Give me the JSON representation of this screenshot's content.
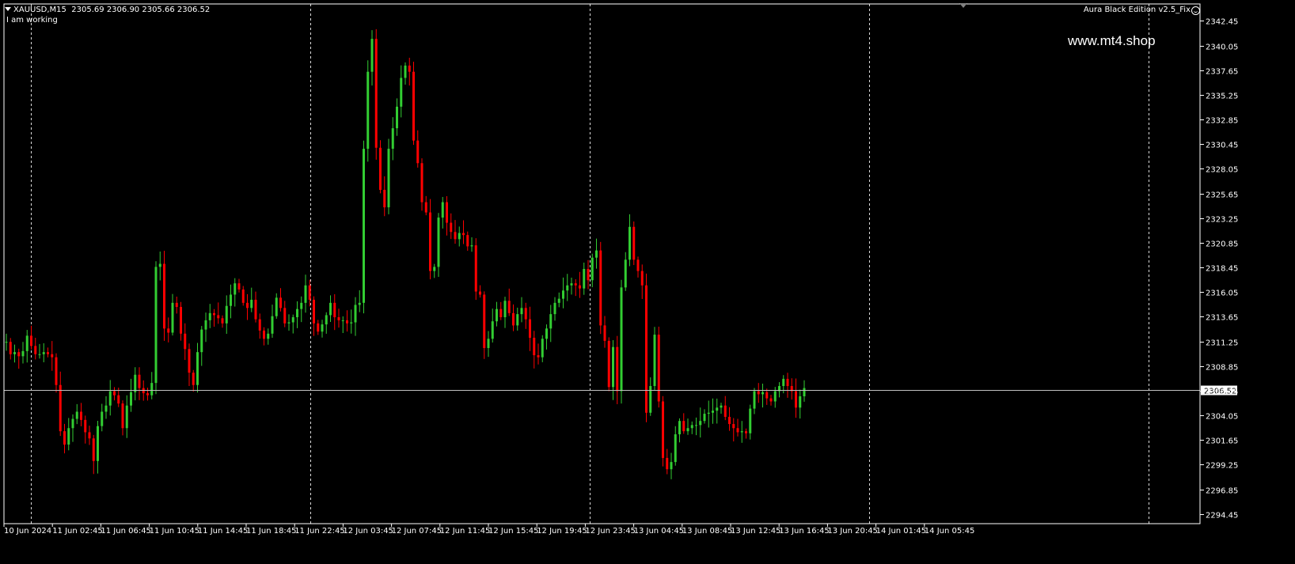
{
  "infobar": {
    "symbol": "XAUUSD,M15",
    "ohlc": "2305.69 2306.90 2305.66 2306.52",
    "status": "I am working"
  },
  "indicator": {
    "name": "Aura Black Edition v2.5_Fix"
  },
  "watermark": "www.mt4.shop",
  "icons": [
    "chart-menu-triangle-icon",
    "smile-icon",
    "shift-marker-icon"
  ],
  "colors": {
    "background": "#000000",
    "bull_candle": "#32CD32",
    "bear_candle": "#FF0000",
    "bid_line": "#C0C0C0",
    "grid_line": "#FFFFFF",
    "price_tag_bg": "#FFFFFF",
    "price_tag_text": "#000000"
  },
  "chart_data": {
    "type": "candlestick",
    "symbol": "XAUUSD",
    "timeframe": "M15",
    "current_price": "2306.52",
    "ylim": [
      2293.5,
      2344.1
    ],
    "y_ticks": [
      "2342.45",
      "2340.05",
      "2337.65",
      "2335.25",
      "2332.85",
      "2330.45",
      "2328.05",
      "2325.65",
      "2323.25",
      "2320.85",
      "2318.45",
      "2316.05",
      "2313.65",
      "2311.25",
      "2308.85",
      "2306.45",
      "2304.05",
      "2301.65",
      "2299.25",
      "2296.85",
      "2294.45"
    ],
    "x_ticks": [
      "10 Jun 2024",
      "11 Jun 02:45",
      "11 Jun 06:45",
      "11 Jun 10:45",
      "11 Jun 14:45",
      "11 Jun 18:45",
      "11 Jun 22:45",
      "12 Jun 03:45",
      "12 Jun 07:45",
      "12 Jun 11:45",
      "12 Jun 15:45",
      "12 Jun 19:45",
      "12 Jun 23:45",
      "13 Jun 04:45",
      "13 Jun 08:45",
      "13 Jun 12:45",
      "13 Jun 16:45",
      "13 Jun 20:45",
      "14 Jun 01:45",
      "14 Jun 05:45"
    ],
    "close_path": [
      2311.2,
      2310.0,
      2310.2,
      2309.8,
      2310.3,
      2311.8,
      2310.8,
      2310.0,
      2310.0,
      2310.2,
      2310.0,
      2309.7,
      2307.0,
      2302.5,
      2301.2,
      2302.8,
      2303.7,
      2304.4,
      2303.6,
      2302.4,
      2301.8,
      2299.6,
      2303.0,
      2304.4,
      2305.0,
      2306.4,
      2306.0,
      2305.2,
      2302.8,
      2305.0,
      2306.3,
      2308.0,
      2306.7,
      2306.2,
      2306.0,
      2307.2,
      2318.5,
      2318.8,
      2312.5,
      2312.1,
      2315.0,
      2314.6,
      2312.0,
      2310.5,
      2308.2,
      2307.0,
      2310.2,
      2312.4,
      2313.3,
      2314.0,
      2313.8,
      2313.5,
      2313.0,
      2314.7,
      2315.8,
      2316.9,
      2316.3,
      2315.0,
      2314.5,
      2315.3,
      2313.4,
      2312.3,
      2311.5,
      2312.0,
      2313.7,
      2315.5,
      2314.5,
      2313.0,
      2313.1,
      2313.6,
      2314.4,
      2315.0,
      2316.7,
      2315.3,
      2313.0,
      2312.2,
      2312.9,
      2313.8,
      2315.0,
      2313.6,
      2313.3,
      2313.3,
      2313.0,
      2313.1,
      2314.8,
      2315.0,
      2330.0,
      2337.5,
      2340.7,
      2330.1,
      2326.0,
      2324.3,
      2330.0,
      2332.0,
      2334.1,
      2336.9,
      2338.1,
      2337.5,
      2330.8,
      2328.6,
      2324.8,
      2323.8,
      2318.1,
      2318.5,
      2323.3,
      2324.8,
      2322.8,
      2321.9,
      2321.2,
      2321.8,
      2321.6,
      2320.5,
      2320.6,
      2316.1,
      2315.8,
      2310.6,
      2311.5,
      2313.2,
      2314.4,
      2313.6,
      2315.2,
      2314.0,
      2312.8,
      2313.9,
      2314.5,
      2313.4,
      2311.6,
      2309.9,
      2309.7,
      2311.5,
      2312.5,
      2313.9,
      2315.0,
      2315.4,
      2316.2,
      2316.7,
      2316.9,
      2316.7,
      2316.4,
      2318.3,
      2317.2,
      2319.4,
      2320.1,
      2312.8,
      2311.3,
      2306.8,
      2310.7,
      2306.4,
      2316.5,
      2319.2,
      2322.4,
      2319.2,
      2318.1,
      2316.7,
      2304.3,
      2306.9,
      2311.9,
      2305.4,
      2299.9,
      2298.8,
      2299.5,
      2302.2,
      2303.5,
      2302.5,
      2302.8,
      2303.1,
      2303.1,
      2303.5,
      2304.2,
      2304.3,
      2304.5,
      2304.8,
      2305.0,
      2303.9,
      2303.2,
      2302.8,
      2302.4,
      2302.5,
      2302.3,
      2304.7,
      2306.4,
      2306.1,
      2306.3,
      2305.7,
      2305.4,
      2306.4,
      2306.9,
      2307.6,
      2306.9,
      2306.4,
      2304.8,
      2305.9,
      2306.7
    ]
  }
}
